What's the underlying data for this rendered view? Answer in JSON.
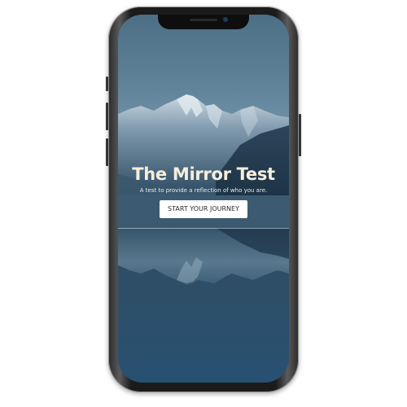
{
  "hero": {
    "title": "The Mirror Test",
    "subtitle": "A test to provide a reflection of who you are.",
    "cta_label": "START YOUR JOURNEY"
  },
  "colors": {
    "title": "#f6eedc",
    "sky": "#5c7f95",
    "water": "#285071",
    "button_bg": "#ffffff",
    "device_frame": "#1b1b1b"
  }
}
